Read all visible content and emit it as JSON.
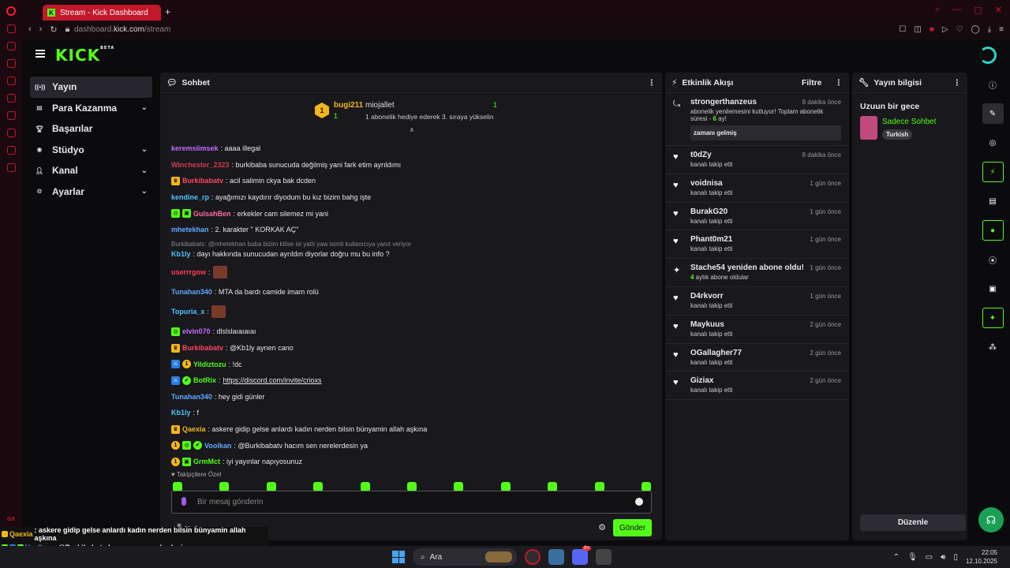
{
  "browser": {
    "tab_title": "Stream - Kick Dashboard",
    "url_host": "dashboard.",
    "url_bold": "kick.com",
    "url_path": "/stream",
    "new_tab": "+",
    "gx": "GX"
  },
  "nav": {
    "logo": "KICK",
    "beta": "BETA"
  },
  "sidebar": {
    "items": [
      {
        "label": "Yayın",
        "icon": "broadcast-icon",
        "active": true
      },
      {
        "label": "Para Kazanma",
        "icon": "money-icon",
        "chev": true
      },
      {
        "label": "Başarılar",
        "icon": "trophy-icon"
      },
      {
        "label": "Stüdyo",
        "icon": "studio-icon",
        "chev": true
      },
      {
        "label": "Kanal",
        "icon": "channel-icon",
        "chev": true
      },
      {
        "label": "Ayarlar",
        "icon": "gear-icon",
        "chev": true
      }
    ]
  },
  "chat": {
    "title": "Sohbet",
    "leader": {
      "rank": "1",
      "user1": "bugi211",
      "count1": "1",
      "user2": "miojallet",
      "count2": "1",
      "message": "1 abonelik hediye ederek 3. sıraya yükselin"
    },
    "messages": [
      {
        "user": "keremsiimsek",
        "color": "#c26bff",
        "text": ": aaaa illegal"
      },
      {
        "user": "Winchester_2323",
        "color": "#d23a4f",
        "text": ": burkibaba sunucuda değilmiş yani fark etim ayrıldımı"
      },
      {
        "user": "Burkibabatv",
        "color": "#ff4466",
        "text": ": acil salimin ckya bak dcden",
        "badges": [
          "crown"
        ]
      },
      {
        "user": "kendine_rp",
        "color": "#4ec3ff",
        "text": ": ayağımızı kaydırır diyodum bu kız bizim bahg işte"
      },
      {
        "user": "GulsahBen",
        "color": "#ff6b9a",
        "text": ": erkekler cam silemez mi yani",
        "badges": [
          "sub",
          "gift"
        ]
      },
      {
        "user": "mhetekhan",
        "color": "#5fa8ff",
        "text": ": 2. karakter \" KORKAK AÇ\""
      },
      {
        "reply": "Burkibabatv: @mhetekhan baba bizim kilise isi yatti yaw isimli kullanıcıya yanıt veriyor",
        "user": "Kb1ly",
        "color": "#4ec3ff",
        "text": ": dayı hakkında sunucudan ayrıldın diyorlar doğru mu bu info ?"
      },
      {
        "user": "userrrgow",
        "color": "#ff3d5a",
        "text": ":",
        "image": true
      },
      {
        "user": "Tunahan340",
        "color": "#5fa8ff",
        "text": ": MTA da bardı camide imam rolü"
      },
      {
        "user": "Topuria_x",
        "color": "#4ec3ff",
        "text": ":",
        "image": true
      },
      {
        "user": "elvin070",
        "color": "#c26bff",
        "text": ": dlslslaıaıaıaı",
        "badges": [
          "sub"
        ]
      },
      {
        "user": "Burkibabatv",
        "color": "#ff4466",
        "text": ": @Kb1ly aynen cano",
        "badges": [
          "crown"
        ]
      },
      {
        "user": "Yildiztozu",
        "color": "#53fc18",
        "text": ": !dc",
        "badges": [
          "mod",
          "gold"
        ]
      },
      {
        "user": "BotRix",
        "color": "#53fc18",
        "text": ": ",
        "link": "https://discord.com/invite/crioxs",
        "badges": [
          "mod",
          "verified"
        ]
      },
      {
        "user": "Tunahan340",
        "color": "#5fa8ff",
        "text": ": hey gidi günler"
      },
      {
        "user": "Kb1ly",
        "color": "#4ec3ff",
        "text": ": f"
      },
      {
        "user": "Qaexia",
        "color": "#f2b61c",
        "text": ": askere gidip gelse anlardı kadın nerden bilsin bünyamin allah aşkına",
        "badges": [
          "crown"
        ]
      },
      {
        "user": "Voolkan",
        "color": "#5fa8ff",
        "text": ": @Burkibabatv hacım sen nerelerdesin ya",
        "badges": [
          "gold",
          "sub",
          "verified"
        ]
      },
      {
        "user": "GrmMct",
        "color": "#53fc18",
        "text": ": iyi yayınlar napıyosunuz",
        "badges": [
          "gold",
          "gift"
        ]
      }
    ],
    "followers_only": "Takipçilere Özel",
    "placeholder": "Bir mesaj gönderin",
    "send": "Gönder",
    "infinity": "∞"
  },
  "activity": {
    "title": "Etkinlik Akışı",
    "filter": "Filtre",
    "items": [
      {
        "name": "strongerthanzeus",
        "time": "8 dakika önce",
        "icon": "refresh",
        "desc_pre": "abonelik yenilemesini kutluyor! Toplam abonelik süresi - ",
        "desc_num": "6",
        "desc_post": " ay!",
        "note": "zamanı gelmiş"
      },
      {
        "name": "t0dZy",
        "time": "8 dakika önce",
        "desc": "kanalı takip etti",
        "icon": "heart"
      },
      {
        "name": "voidnisa",
        "time": "1 gün önce",
        "desc": "kanalı takip etti",
        "icon": "heart"
      },
      {
        "name": "BurakG20",
        "time": "1 gün önce",
        "desc": "kanalı takip etti",
        "icon": "heart"
      },
      {
        "name": "Phant0m21",
        "time": "1 gün önce",
        "desc": "kanalı takip etti",
        "icon": "heart"
      },
      {
        "name": "Stache54 yeniden abone oldu!",
        "time": "1 gün önce",
        "icon": "star",
        "desc_num": "4",
        "desc_post": " aylık abone oldular"
      },
      {
        "name": "D4rkvorr",
        "time": "1 gün önce",
        "desc": "kanalı takip etti",
        "icon": "heart"
      },
      {
        "name": "Maykuus",
        "time": "2 gün önce",
        "desc": "kanalı takip etti",
        "icon": "heart"
      },
      {
        "name": "OGallagher77",
        "time": "2 gün önce",
        "desc": "kanalı takip etti",
        "icon": "heart"
      },
      {
        "name": "Giziax",
        "time": "2 gün önce",
        "desc": "kanalı takip etti",
        "icon": "heart"
      }
    ]
  },
  "info": {
    "title": "Yayın bilgisi",
    "stream_title": "Uzuun bir gece",
    "category": "Sadece Sohbet",
    "tag": "Turkish",
    "edit": "Düzenle"
  },
  "overlay": [
    {
      "user": "Qaexia",
      "text": ": askere gidip gelse anlardı kadın nerden bilsin bünyamin allah aşkına"
    },
    {
      "user": "Voolkan",
      "text": ": @Burkibabatv hacım sen nerelerdesin ya"
    },
    {
      "user": "GrmMct",
      "text": ": iyi yayınlar napıyosunuz"
    }
  ],
  "taskbar": {
    "search": "Ara",
    "time": "22:05",
    "date": "12.10.2025",
    "discord_badge": "9+"
  },
  "colors": {
    "accent": "#53fc18",
    "opera": "#c2182a"
  }
}
